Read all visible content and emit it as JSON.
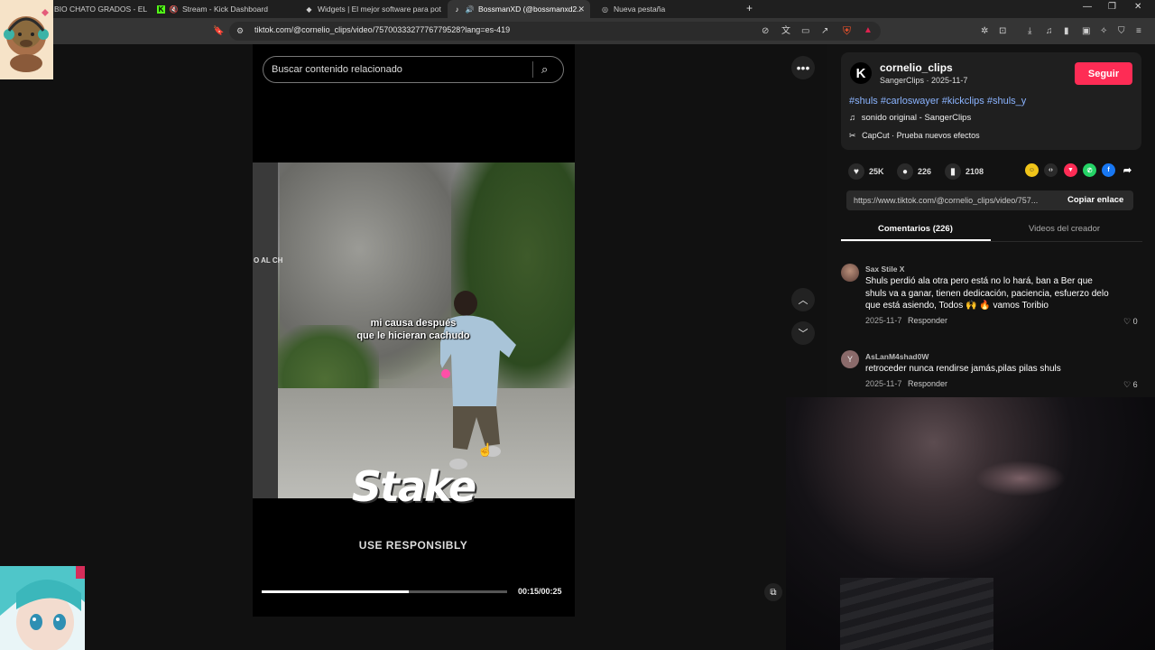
{
  "browser": {
    "tabs": [
      {
        "title": "BIO CHATO GRADOS - EL P",
        "active": false
      },
      {
        "title": "Stream - Kick Dashboard",
        "active": false
      },
      {
        "title": "Widgets | El mejor software para pot",
        "active": false
      },
      {
        "title": "BossmanXD (@bossmanxd2...",
        "active": true
      },
      {
        "title": "Nueva pestaña",
        "active": false
      }
    ],
    "url": "tiktok.com/@cornelio_clips/video/7570033327776779528?lang=es-419"
  },
  "search": {
    "placeholder": "Buscar contenido relacionado"
  },
  "video": {
    "caption_line1": "mi causa después",
    "caption_line2": "que le hicieran cachudo",
    "side_text": "O AL CH",
    "sponsor_logo": "Stake",
    "sponsor_tagline": "USE RESPONSIBLY",
    "time": "00:15/00:25",
    "progress": 0.6
  },
  "creator": {
    "username": "cornelio_clips",
    "meta": "SangerClips · 2025-11-7",
    "follow_label": "Seguir",
    "hashtags": "#shuls #carloswayer #kickclips #shuls_y",
    "sound": "sonido original - SangerClips",
    "capcut": "CapCut · Prueba nuevos efectos"
  },
  "stats": {
    "likes": "25K",
    "comments": "226",
    "saves": "2108"
  },
  "link": {
    "url": "https://www.tiktok.com/@cornelio_clips/video/757...",
    "copy_label": "Copiar enlace"
  },
  "panel_tabs": {
    "comments": "Comentarios (226)",
    "creator_videos": "Videos del creador"
  },
  "comments": [
    {
      "user": "Sax Stile X",
      "text": "Shuls perdió ala otra pero está no lo hará, ban a Ber que shuls va a ganar, tienen dedicación, paciencia, esfuerzo delo que está asiendo, Todos 🙌 🔥 vamos Toribio",
      "date": "2025-11-7",
      "reply": "Responder",
      "likes": "0"
    },
    {
      "user": "AsLanM4shad0W",
      "text": "retroceder nunca rendirse jamás,pilas pilas shuls",
      "date": "2025-11-7",
      "reply": "Responder",
      "likes": "6",
      "avatar_letter": "Y"
    }
  ],
  "colors": {
    "accent": "#fe2c55",
    "hashtag": "#8bb4ff",
    "background": "#111111"
  }
}
